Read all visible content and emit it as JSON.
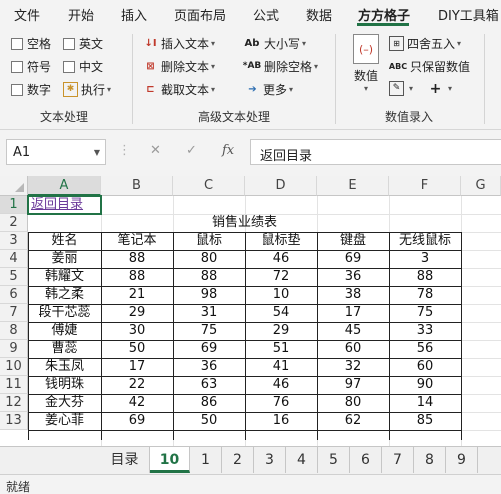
{
  "ribbon_tabs": [
    "文件",
    "开始",
    "插入",
    "页面布局",
    "公式",
    "数据",
    "方方格子",
    "DIY工具箱"
  ],
  "active_tab": "方方格子",
  "groups": {
    "text_processing": {
      "label": "文本处理",
      "checkboxes": [
        "空格",
        "英文",
        "符号",
        "中文",
        "数字"
      ],
      "execute": "执行"
    },
    "advanced_text": {
      "label": "高级文本处理",
      "items": [
        "插入文本",
        "删除文本",
        "截取文本",
        "大小写",
        "删除空格",
        "更多"
      ]
    },
    "numeric_entry": {
      "label": "数值录入",
      "big_button": "数值",
      "items": [
        "四舍五入",
        "只保留数值"
      ]
    }
  },
  "formula_bar": {
    "name_box": "A1",
    "cancel_icon": "✕",
    "enter_icon": "✓",
    "fx_label": "fx",
    "content": "返回目录"
  },
  "columns": [
    "A",
    "B",
    "C",
    "D",
    "E",
    "F",
    "G"
  ],
  "rows": [
    "1",
    "2",
    "3",
    "4",
    "5",
    "6",
    "7",
    "8",
    "9",
    "10",
    "11",
    "12",
    "13"
  ],
  "sheet": {
    "link_text": "返回目录",
    "title": "销售业绩表",
    "headers": [
      "姓名",
      "笔记本",
      "鼠标",
      "鼠标垫",
      "键盘",
      "无线鼠标"
    ],
    "data": [
      [
        "姜丽",
        "88",
        "80",
        "46",
        "69",
        "3"
      ],
      [
        "韩耀文",
        "88",
        "88",
        "72",
        "36",
        "88"
      ],
      [
        "韩之柔",
        "21",
        "98",
        "10",
        "38",
        "78"
      ],
      [
        "段干芯蕊",
        "29",
        "31",
        "54",
        "17",
        "75"
      ],
      [
        "傅婕",
        "30",
        "75",
        "29",
        "45",
        "33"
      ],
      [
        "曹蕊",
        "50",
        "69",
        "51",
        "60",
        "56"
      ],
      [
        "朱玉凤",
        "17",
        "36",
        "41",
        "32",
        "60"
      ],
      [
        "钱明珠",
        "22",
        "63",
        "46",
        "97",
        "90"
      ],
      [
        "金大芬",
        "42",
        "86",
        "76",
        "80",
        "14"
      ],
      [
        "姜心菲",
        "69",
        "50",
        "16",
        "62",
        "85"
      ]
    ]
  },
  "sheet_tabs": [
    "目录",
    "10",
    "1",
    "2",
    "3",
    "4",
    "5",
    "6",
    "7",
    "8",
    "9"
  ],
  "active_sheet": "10",
  "status": "就绪",
  "colors": {
    "accent": "#217346",
    "link": "#6b3a9a"
  }
}
